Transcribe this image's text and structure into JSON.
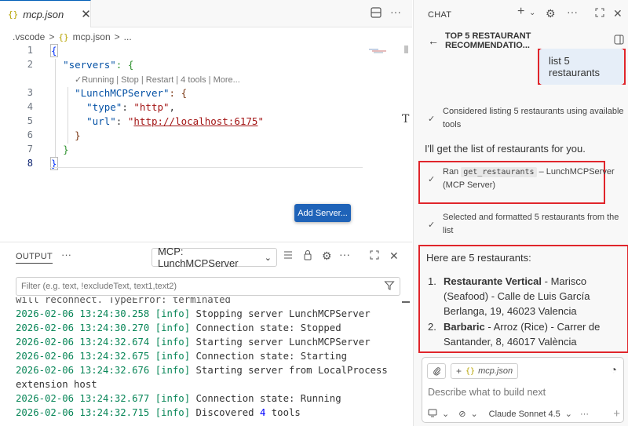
{
  "editor": {
    "tab_label": "mcp.json",
    "tab_icon": "{}",
    "tab_close": "✕",
    "breadcrumb": [
      ".vscode",
      "mcp.json",
      "..."
    ],
    "breadcrumb_sep": ">",
    "codelens": "✓Running | Stop | Restart | 4 tools | More...",
    "add_server_button": "Add Server...",
    "lines": {
      "n1": "1",
      "n2": "2",
      "n3": "3",
      "n4": "4",
      "n5": "5",
      "n6": "6",
      "n7": "7",
      "n8": "8",
      "l1_brace": "{",
      "l2_key": "\"servers\"",
      "l2_rest": ": {",
      "l3_key": "\"LunchMCPServer\"",
      "l3_rest": ": {",
      "l4_key": "\"type\"",
      "l4_colon": ": ",
      "l4_val": "\"http\"",
      "l4_comma": ",",
      "l5_key": "\"url\"",
      "l5_colon": ": ",
      "l5_q1": "\"",
      "l5_url": "http://localhost:6175",
      "l5_q2": "\"",
      "l6_brace": "}",
      "l7_brace": "}",
      "l8_brace": "}"
    }
  },
  "output": {
    "title": "OUTPUT",
    "more": "···",
    "channel": "MCP: LunchMCPServer",
    "filter_placeholder": "Filter (e.g. text, !excludeText, text1,text2)",
    "partial_line": "will reconnect. TypeError: terminated",
    "log": [
      {
        "ts": "2026-02-06 13:24:30.258",
        "lvl": "[info]",
        "msg": " Stopping server LunchMCPServer"
      },
      {
        "ts": "2026-02-06 13:24:30.270",
        "lvl": "[info]",
        "msg": " Connection state: Stopped"
      },
      {
        "ts": "2026-02-06 13:24:32.674",
        "lvl": "[info]",
        "msg": " Starting server LunchMCPServer"
      },
      {
        "ts": "2026-02-06 13:24:32.675",
        "lvl": "[info]",
        "msg": " Connection state: Starting"
      },
      {
        "ts": "2026-02-06 13:24:32.676",
        "lvl": "[info]",
        "msg": " Starting server from LocalProcess"
      },
      {
        "ts": "",
        "lvl": "",
        "msg": "extension host"
      },
      {
        "ts": "2026-02-06 13:24:32.677",
        "lvl": "[info]",
        "msg": " Connection state: Running"
      },
      {
        "ts": "2026-02-06 13:24:32.715",
        "lvl": "[info]",
        "msg": " Discovered ",
        "num": "4",
        "tail": " tools"
      }
    ]
  },
  "chat": {
    "header": "CHAT",
    "session_title": "TOP 5 RESTAURANT RECOMMENDATIO...",
    "user_message": "list 5 restaurants",
    "step1": "Considered listing 5 restaurants using available tools",
    "reply1": "I'll get the list of restaurants for you.",
    "step2_pre": "Ran ",
    "step2_tool": "get_restaurants",
    "step2_post": " – LunchMCPServer (MCP Server)",
    "step3": "Selected and formatted 5 restaurants from the list",
    "answer_head": "Here are 5 restaurants:",
    "restaurants": [
      {
        "num": "1.",
        "name": "Restaurante Vertical",
        "detail": " - Marisco (Seafood) - Calle de Luis García Berlanga, 19, 46023 Valencia"
      },
      {
        "num": "2.",
        "name": "Barbaric",
        "detail": " - Arroz (Rice) - Carrer de Santander, 8, 46017 València"
      }
    ],
    "context_file": "mcp.json",
    "input_placeholder": "Describe what to build next",
    "model": "Claude Sonnet 4.5"
  }
}
